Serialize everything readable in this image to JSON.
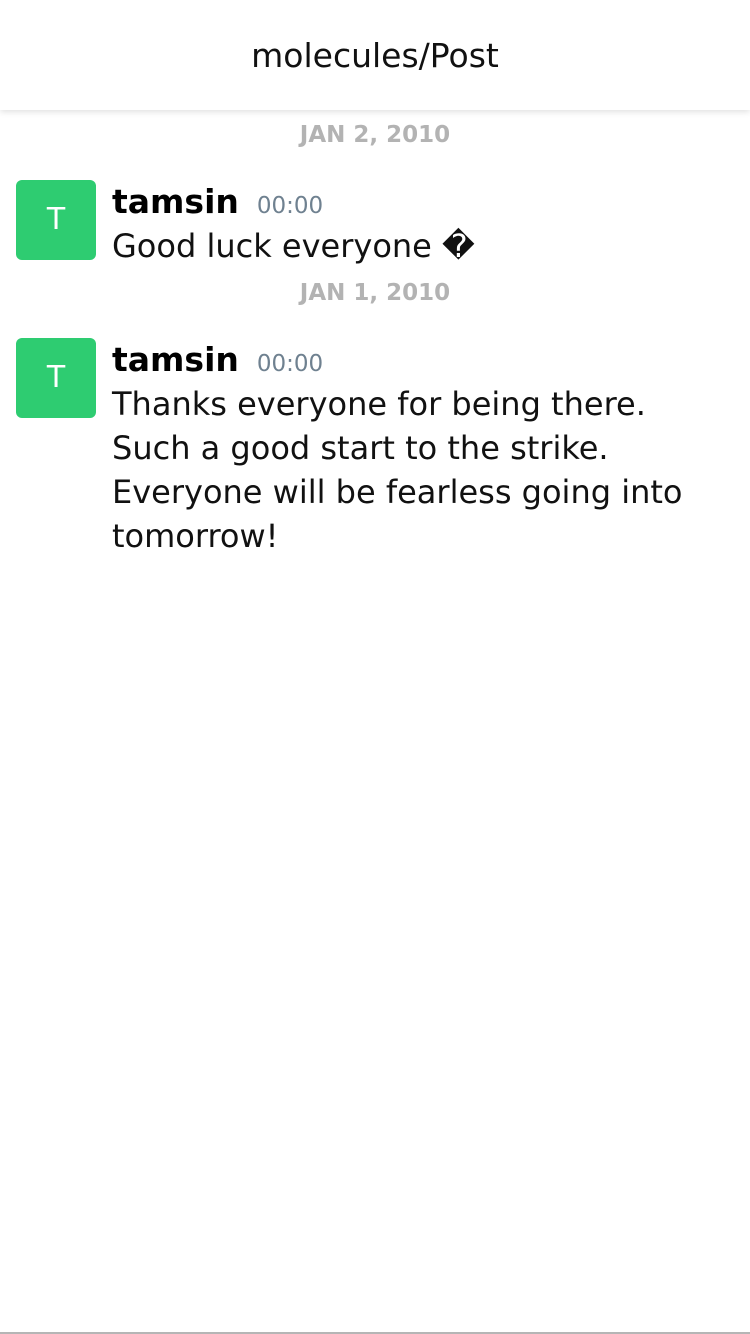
{
  "header": {
    "title": "molecules/Post"
  },
  "colors": {
    "avatar": "#2ecc71",
    "timestamp": "#6f8190",
    "date_separator": "#b3b3b3"
  },
  "feed": [
    {
      "date": "JAN 2, 2010",
      "avatar_initial": "T",
      "author": "tamsin",
      "time": "00:00",
      "text": "Good luck everyone �"
    },
    {
      "date": "JAN 1, 2010",
      "avatar_initial": "T",
      "author": "tamsin",
      "time": "00:00",
      "text": "Thanks everyone for being there. Such a good start to the strike. Everyone will be fearless going into tomorrow!"
    }
  ]
}
